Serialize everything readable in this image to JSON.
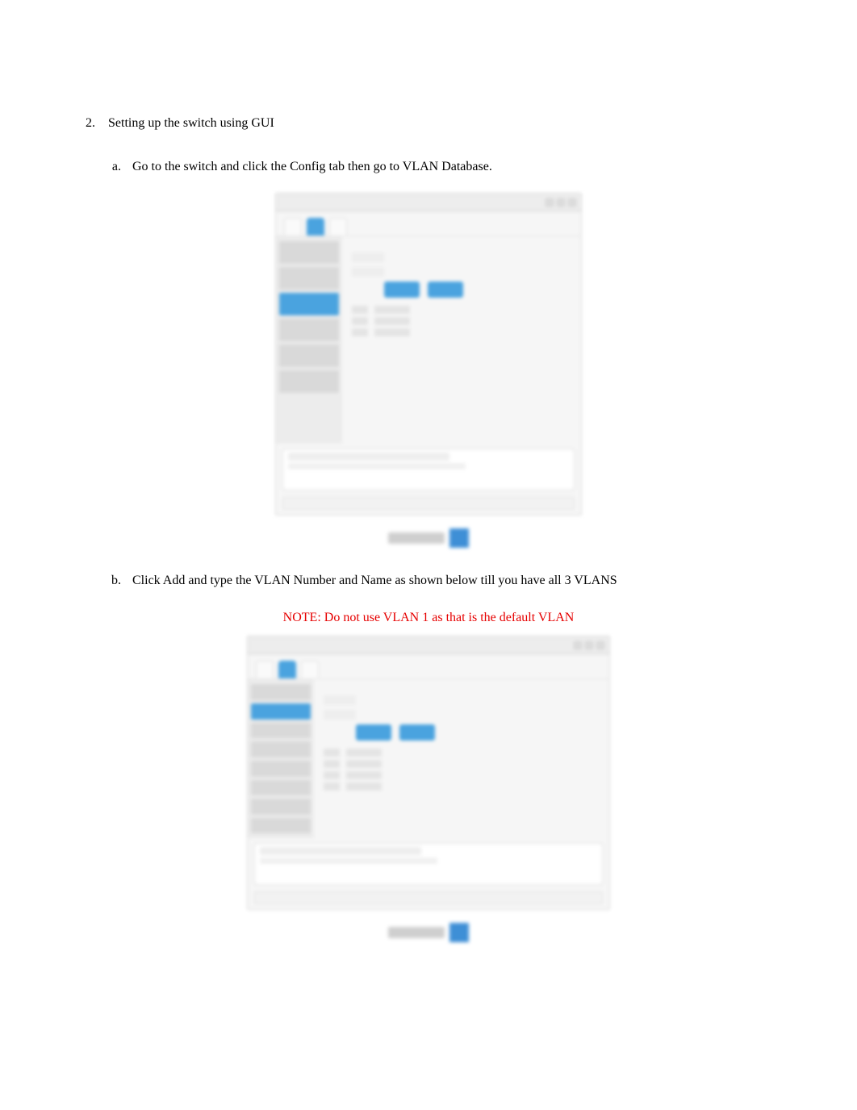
{
  "step2": {
    "number_label": "2.",
    "title": "Setting up the switch using GUI",
    "sub_a": {
      "letter": "a.",
      "text": "Go to the switch and click the Config tab then go to VLAN Database."
    },
    "sub_b": {
      "letter": "b.",
      "text": "Click Add and type the VLAN Number and Name as shown below till you have all 3 VLANS"
    },
    "note_text": "NOTE: Do not use VLAN 1 as that is the default VLAN"
  },
  "note_color": "#e60000"
}
